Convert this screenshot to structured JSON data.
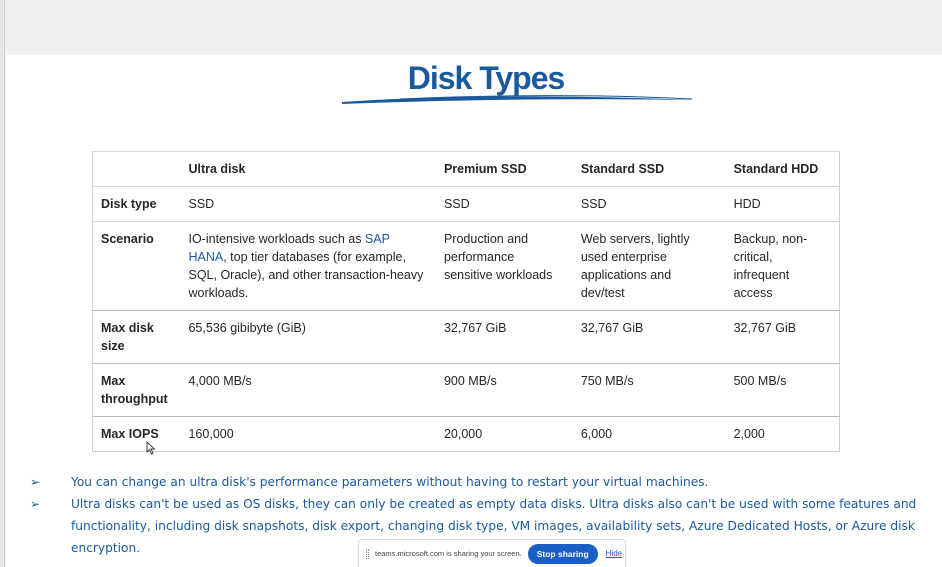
{
  "slide": {
    "title": "Disk Types"
  },
  "table": {
    "headers": [
      "",
      "Ultra disk",
      "Premium SSD",
      "Standard SSD",
      "Standard HDD"
    ],
    "rows": [
      {
        "label": "Disk type",
        "cells": [
          "SSD",
          "SSD",
          "SSD",
          "HDD"
        ]
      },
      {
        "label": "Scenario",
        "cells": [
          {
            "before": "IO-intensive workloads such as ",
            "link": "SAP HANA",
            "after": ", top tier databases (for example, SQL, Oracle), and other transaction-heavy workloads."
          },
          "Production and performance sensitive workloads",
          "Web servers, lightly used enterprise applications and dev/test",
          "Backup, non-critical, infrequent access"
        ]
      },
      {
        "label": "Max disk size",
        "cells": [
          "65,536 gibibyte (GiB)",
          "32,767 GiB",
          "32,767 GiB",
          "32,767 GiB"
        ]
      },
      {
        "label": "Max throughput",
        "cells": [
          "4,000 MB/s",
          "900 MB/s",
          "750 MB/s",
          "500 MB/s"
        ]
      },
      {
        "label": "Max IOPS",
        "cells": [
          "160,000",
          "20,000",
          "6,000",
          "2,000"
        ]
      }
    ]
  },
  "bullets": [
    "You can change an ultra disk's performance parameters without having to restart your virtual machines.",
    "Ultra disks can't be used as OS disks, they can only be created as empty data disks. Ultra disks also can't be used with some features and functionality, including disk snapshots, disk export, changing disk type, VM images, availability sets, Azure Dedicated Hosts, or Azure disk encryption."
  ],
  "share_bar": {
    "message": "teams.microsoft.com is sharing your screen.",
    "stop_label": "Stop sharing",
    "hide_label": "Hide"
  },
  "colors": {
    "accent": "#1a5a9c",
    "button": "#1a5fc4"
  },
  "icons": {
    "bullet": "arrowhead-bullet-icon",
    "cursor": "mouse-pointer-icon",
    "grip": "drag-grip-icon"
  }
}
